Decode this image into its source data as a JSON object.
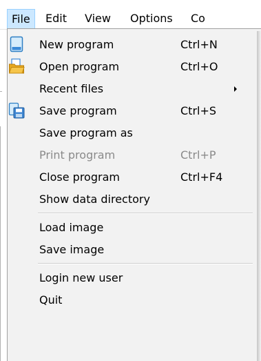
{
  "menubar": {
    "items": [
      {
        "label": "File"
      },
      {
        "label": "Edit"
      },
      {
        "label": "View"
      },
      {
        "label": "Options"
      },
      {
        "label": "Co"
      }
    ]
  },
  "file_menu": {
    "items": [
      {
        "label": "New program",
        "shortcut": "Ctrl+N",
        "icon": "new-file-icon"
      },
      {
        "label": "Open program",
        "shortcut": "Ctrl+O",
        "icon": "open-folder-icon"
      },
      {
        "label": "Recent files",
        "shortcut": "",
        "submenu": true
      },
      {
        "label": "Save program",
        "shortcut": "Ctrl+S",
        "icon": "save-icon"
      },
      {
        "label": "Save program as",
        "shortcut": ""
      },
      {
        "label": "Print program",
        "shortcut": "Ctrl+P",
        "disabled": true
      },
      {
        "label": "Close program",
        "shortcut": "Ctrl+F4"
      },
      {
        "label": "Show data directory",
        "shortcut": ""
      },
      {
        "label": "Load image",
        "shortcut": ""
      },
      {
        "label": "Save image",
        "shortcut": ""
      },
      {
        "label": "Login new user",
        "shortcut": ""
      },
      {
        "label": "Quit",
        "shortcut": ""
      }
    ]
  },
  "colors": {
    "menu_background": "#f2f2f2",
    "active_menu_highlight": "#cce8ff",
    "disabled_text": "#8a8a8a"
  }
}
